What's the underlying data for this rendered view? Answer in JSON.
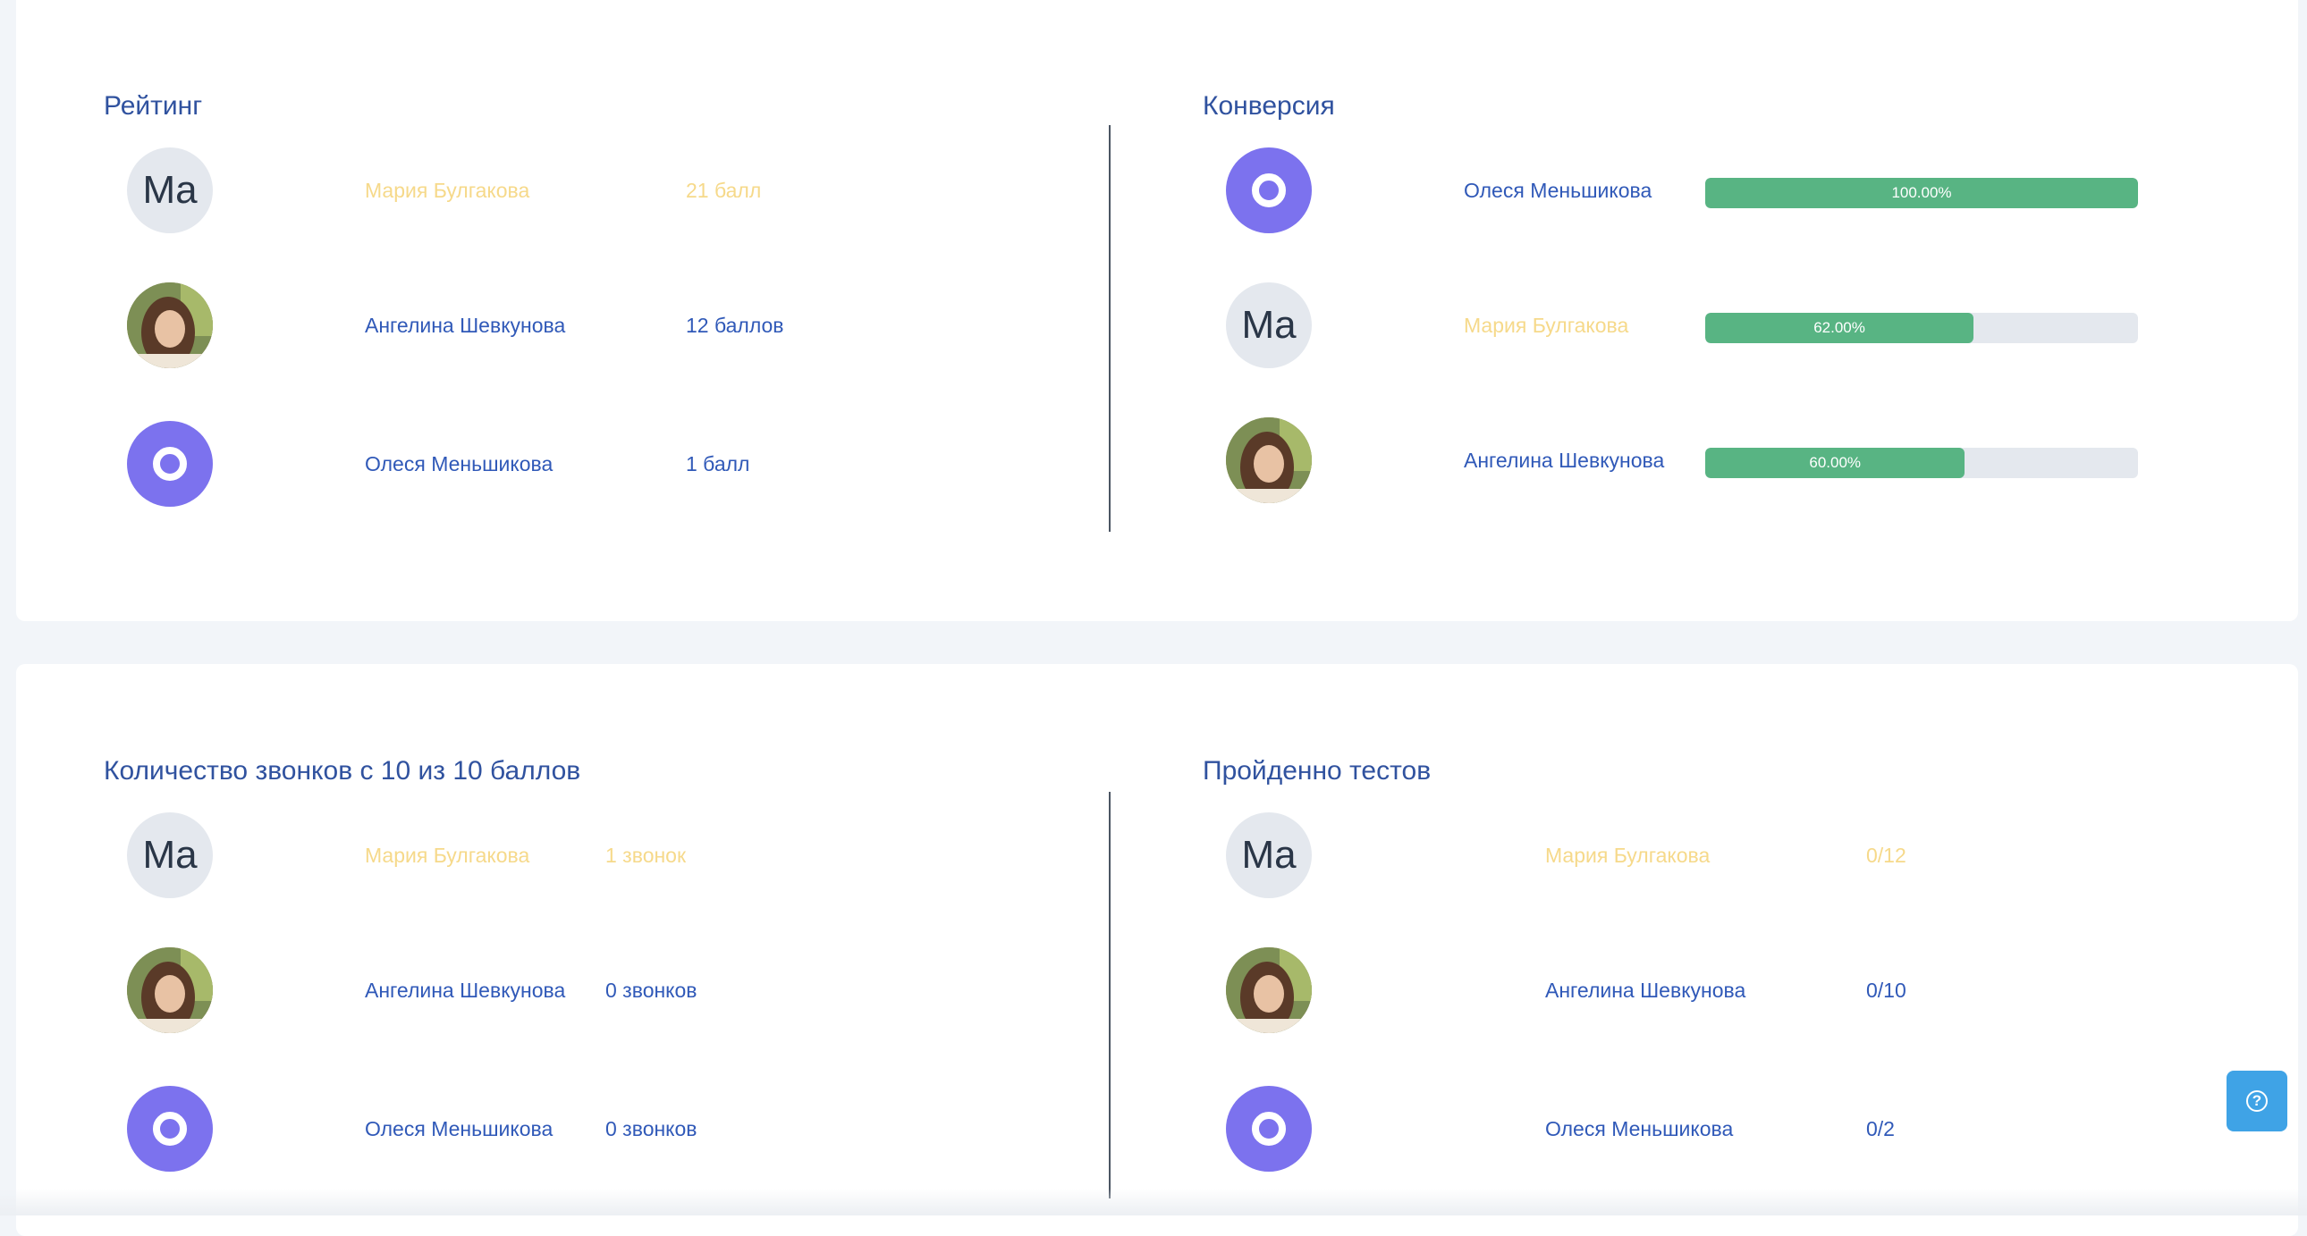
{
  "rating": {
    "title": "Рейтинг",
    "rows": [
      {
        "avatar": "Ma",
        "avatar_type": "initials",
        "name": "Мария Булгакова",
        "value": "21 балл",
        "tone": "yellow"
      },
      {
        "avatar": "",
        "avatar_type": "photo",
        "name": "Ангелина Шевкунова",
        "value": "12 баллов",
        "tone": "blue"
      },
      {
        "avatar": "",
        "avatar_type": "ring",
        "name": "Олеся Меньшикова",
        "value": "1 балл",
        "tone": "blue"
      }
    ]
  },
  "conversion": {
    "title": "Конверсия",
    "rows": [
      {
        "avatar": "",
        "avatar_type": "ring",
        "name": "Олеся Меньшикова",
        "percent": 100,
        "label": "100.00%",
        "tone": "blue"
      },
      {
        "avatar": "Ma",
        "avatar_type": "initials",
        "name": "Мария Булгакова",
        "percent": 62,
        "label": "62.00%",
        "tone": "yellow"
      },
      {
        "avatar": "",
        "avatar_type": "photo",
        "name": "Ангелина Шевкунова",
        "percent": 60,
        "label": "60.00%",
        "tone": "blue"
      }
    ]
  },
  "calls": {
    "title": "Количество звонков с 10 из 10 баллов",
    "rows": [
      {
        "avatar": "Ma",
        "avatar_type": "initials",
        "name": "Мария Булгакова",
        "value": "1 звонок",
        "tone": "yellow"
      },
      {
        "avatar": "",
        "avatar_type": "photo",
        "name": "Ангелина Шевкунова",
        "value": "0 звонков",
        "tone": "blue"
      },
      {
        "avatar": "",
        "avatar_type": "ring",
        "name": "Олеся Меньшикова",
        "value": "0 звонков",
        "tone": "blue"
      }
    ]
  },
  "tests": {
    "title": "Пройденно тестов",
    "rows": [
      {
        "avatar": "Ma",
        "avatar_type": "initials",
        "name": "Мария Булгакова",
        "value": "0/12",
        "tone": "yellow"
      },
      {
        "avatar": "",
        "avatar_type": "photo",
        "name": "Ангелина Шевкунова",
        "value": "0/10",
        "tone": "blue"
      },
      {
        "avatar": "",
        "avatar_type": "ring",
        "name": "Олеся Меньшикова",
        "value": "0/2",
        "tone": "blue"
      }
    ]
  },
  "colors": {
    "title": "#30529f",
    "name_blue": "#3059b8",
    "name_yellow": "#f6d98a",
    "bar_fill": "#58b483",
    "bar_track": "#e4e8ee",
    "avatar_ring": "#7c72ee",
    "help_button": "#3fa3e6"
  },
  "help": {
    "icon": "question-circle-icon"
  }
}
